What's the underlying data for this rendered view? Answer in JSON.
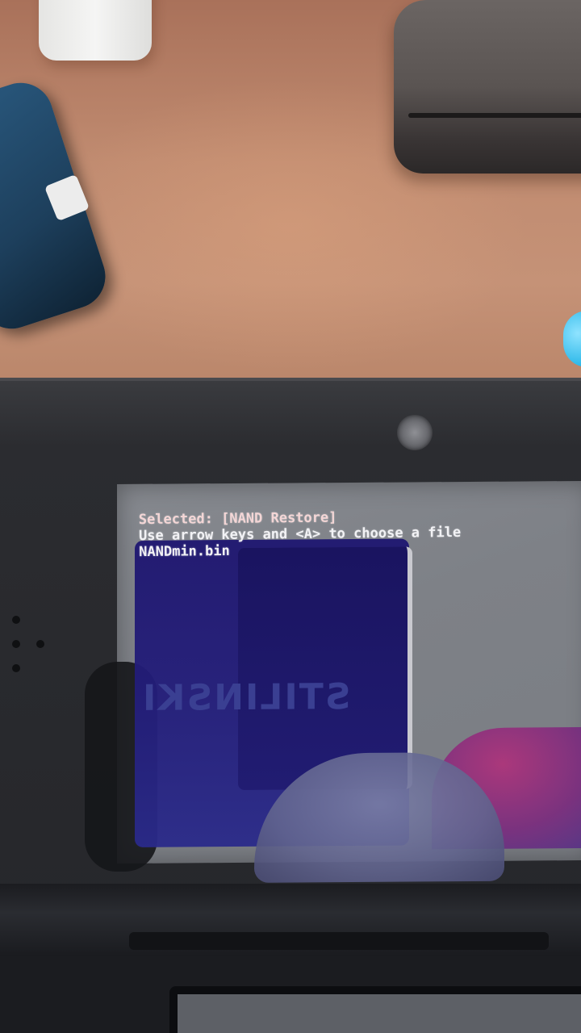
{
  "screen": {
    "lines": {
      "selected": "Selected: [NAND Restore]",
      "instruction": "Use arrow keys and <A> to choose a file",
      "file": "NANDmin.bin"
    },
    "reflection_text": "STILINSKI"
  },
  "colors": {
    "desk": "#c08b70",
    "console_body": "#25262a",
    "screen_bg": "#80838a",
    "text": "#f2f2f5"
  }
}
